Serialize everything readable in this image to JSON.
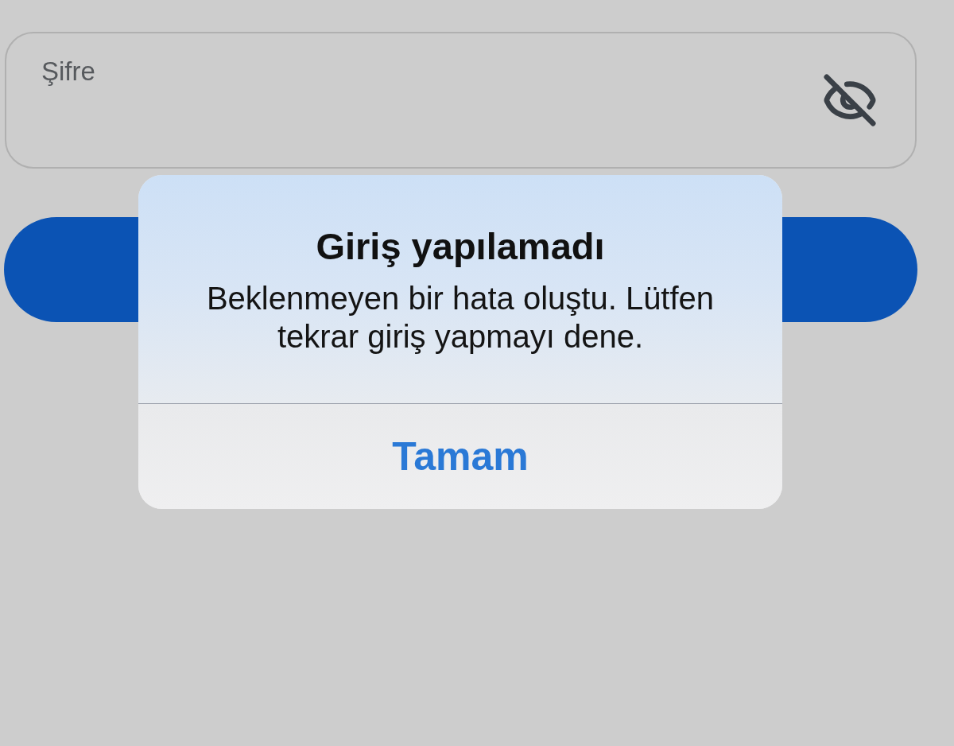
{
  "password_field": {
    "label": "Şifre"
  },
  "alert": {
    "title": "Giriş yapılamadı",
    "message": "Beklenmeyen bir hata oluştu. Lütfen tekrar giriş yapmayı dene.",
    "buttons": [
      {
        "label": "Tamam"
      }
    ]
  }
}
